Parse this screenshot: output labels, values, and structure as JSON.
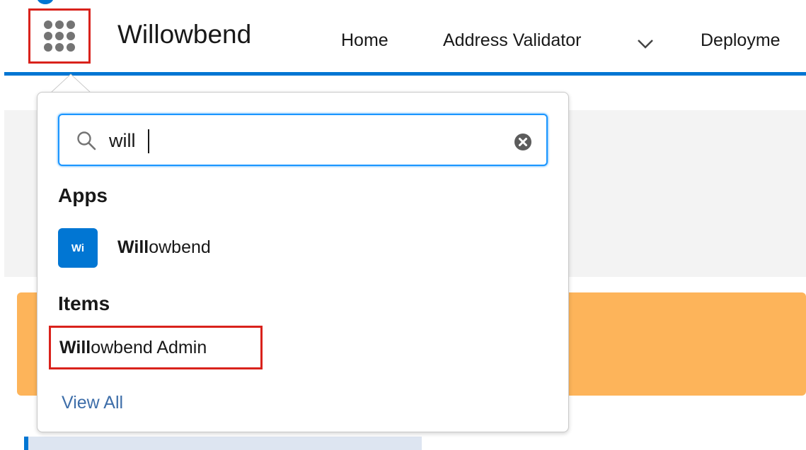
{
  "header": {
    "app_name": "Willowbend",
    "nav": [
      {
        "label": "Home"
      },
      {
        "label": "Address Validator"
      },
      {
        "label": "Deployme"
      }
    ]
  },
  "launcher": {
    "search": {
      "value": "will"
    },
    "sections": {
      "apps_title": "Apps",
      "items_title": "Items"
    },
    "apps": [
      {
        "badge": "Wi",
        "label_match": "Will",
        "label_rest": "owbend"
      }
    ],
    "items": [
      {
        "label_match": "Will",
        "label_rest": "owbend Admin"
      }
    ],
    "view_all_label": "View All"
  },
  "colors": {
    "brand_blue": "#0176d3",
    "highlight_red": "#d9221c",
    "banner_orange": "#fdb45a",
    "link_blue": "#3e6ea9"
  },
  "icons": {
    "launcher": "app-launcher-waffle-icon",
    "search": "search-icon",
    "clear": "clear-icon",
    "nav_chevron": "chevron-down-icon"
  }
}
